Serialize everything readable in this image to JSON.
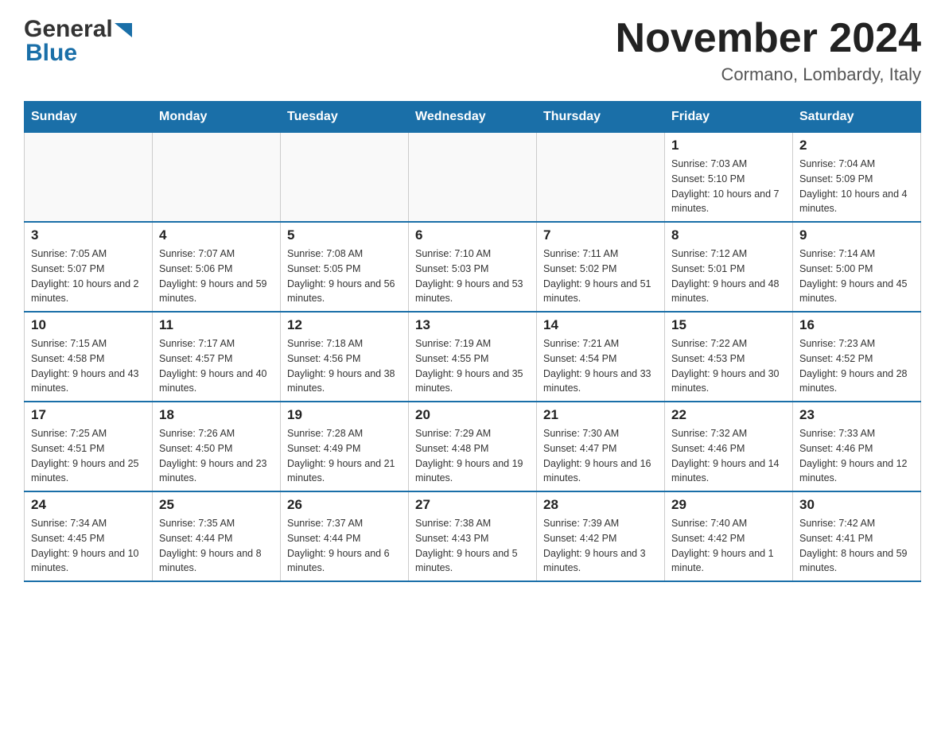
{
  "header": {
    "logo_general": "General",
    "logo_blue": "Blue",
    "month_title": "November 2024",
    "location": "Cormano, Lombardy, Italy"
  },
  "weekdays": [
    "Sunday",
    "Monday",
    "Tuesday",
    "Wednesday",
    "Thursday",
    "Friday",
    "Saturday"
  ],
  "weeks": [
    [
      {
        "day": "",
        "info": ""
      },
      {
        "day": "",
        "info": ""
      },
      {
        "day": "",
        "info": ""
      },
      {
        "day": "",
        "info": ""
      },
      {
        "day": "",
        "info": ""
      },
      {
        "day": "1",
        "info": "Sunrise: 7:03 AM\nSunset: 5:10 PM\nDaylight: 10 hours and 7 minutes."
      },
      {
        "day": "2",
        "info": "Sunrise: 7:04 AM\nSunset: 5:09 PM\nDaylight: 10 hours and 4 minutes."
      }
    ],
    [
      {
        "day": "3",
        "info": "Sunrise: 7:05 AM\nSunset: 5:07 PM\nDaylight: 10 hours and 2 minutes."
      },
      {
        "day": "4",
        "info": "Sunrise: 7:07 AM\nSunset: 5:06 PM\nDaylight: 9 hours and 59 minutes."
      },
      {
        "day": "5",
        "info": "Sunrise: 7:08 AM\nSunset: 5:05 PM\nDaylight: 9 hours and 56 minutes."
      },
      {
        "day": "6",
        "info": "Sunrise: 7:10 AM\nSunset: 5:03 PM\nDaylight: 9 hours and 53 minutes."
      },
      {
        "day": "7",
        "info": "Sunrise: 7:11 AM\nSunset: 5:02 PM\nDaylight: 9 hours and 51 minutes."
      },
      {
        "day": "8",
        "info": "Sunrise: 7:12 AM\nSunset: 5:01 PM\nDaylight: 9 hours and 48 minutes."
      },
      {
        "day": "9",
        "info": "Sunrise: 7:14 AM\nSunset: 5:00 PM\nDaylight: 9 hours and 45 minutes."
      }
    ],
    [
      {
        "day": "10",
        "info": "Sunrise: 7:15 AM\nSunset: 4:58 PM\nDaylight: 9 hours and 43 minutes."
      },
      {
        "day": "11",
        "info": "Sunrise: 7:17 AM\nSunset: 4:57 PM\nDaylight: 9 hours and 40 minutes."
      },
      {
        "day": "12",
        "info": "Sunrise: 7:18 AM\nSunset: 4:56 PM\nDaylight: 9 hours and 38 minutes."
      },
      {
        "day": "13",
        "info": "Sunrise: 7:19 AM\nSunset: 4:55 PM\nDaylight: 9 hours and 35 minutes."
      },
      {
        "day": "14",
        "info": "Sunrise: 7:21 AM\nSunset: 4:54 PM\nDaylight: 9 hours and 33 minutes."
      },
      {
        "day": "15",
        "info": "Sunrise: 7:22 AM\nSunset: 4:53 PM\nDaylight: 9 hours and 30 minutes."
      },
      {
        "day": "16",
        "info": "Sunrise: 7:23 AM\nSunset: 4:52 PM\nDaylight: 9 hours and 28 minutes."
      }
    ],
    [
      {
        "day": "17",
        "info": "Sunrise: 7:25 AM\nSunset: 4:51 PM\nDaylight: 9 hours and 25 minutes."
      },
      {
        "day": "18",
        "info": "Sunrise: 7:26 AM\nSunset: 4:50 PM\nDaylight: 9 hours and 23 minutes."
      },
      {
        "day": "19",
        "info": "Sunrise: 7:28 AM\nSunset: 4:49 PM\nDaylight: 9 hours and 21 minutes."
      },
      {
        "day": "20",
        "info": "Sunrise: 7:29 AM\nSunset: 4:48 PM\nDaylight: 9 hours and 19 minutes."
      },
      {
        "day": "21",
        "info": "Sunrise: 7:30 AM\nSunset: 4:47 PM\nDaylight: 9 hours and 16 minutes."
      },
      {
        "day": "22",
        "info": "Sunrise: 7:32 AM\nSunset: 4:46 PM\nDaylight: 9 hours and 14 minutes."
      },
      {
        "day": "23",
        "info": "Sunrise: 7:33 AM\nSunset: 4:46 PM\nDaylight: 9 hours and 12 minutes."
      }
    ],
    [
      {
        "day": "24",
        "info": "Sunrise: 7:34 AM\nSunset: 4:45 PM\nDaylight: 9 hours and 10 minutes."
      },
      {
        "day": "25",
        "info": "Sunrise: 7:35 AM\nSunset: 4:44 PM\nDaylight: 9 hours and 8 minutes."
      },
      {
        "day": "26",
        "info": "Sunrise: 7:37 AM\nSunset: 4:44 PM\nDaylight: 9 hours and 6 minutes."
      },
      {
        "day": "27",
        "info": "Sunrise: 7:38 AM\nSunset: 4:43 PM\nDaylight: 9 hours and 5 minutes."
      },
      {
        "day": "28",
        "info": "Sunrise: 7:39 AM\nSunset: 4:42 PM\nDaylight: 9 hours and 3 minutes."
      },
      {
        "day": "29",
        "info": "Sunrise: 7:40 AM\nSunset: 4:42 PM\nDaylight: 9 hours and 1 minute."
      },
      {
        "day": "30",
        "info": "Sunrise: 7:42 AM\nSunset: 4:41 PM\nDaylight: 8 hours and 59 minutes."
      }
    ]
  ]
}
